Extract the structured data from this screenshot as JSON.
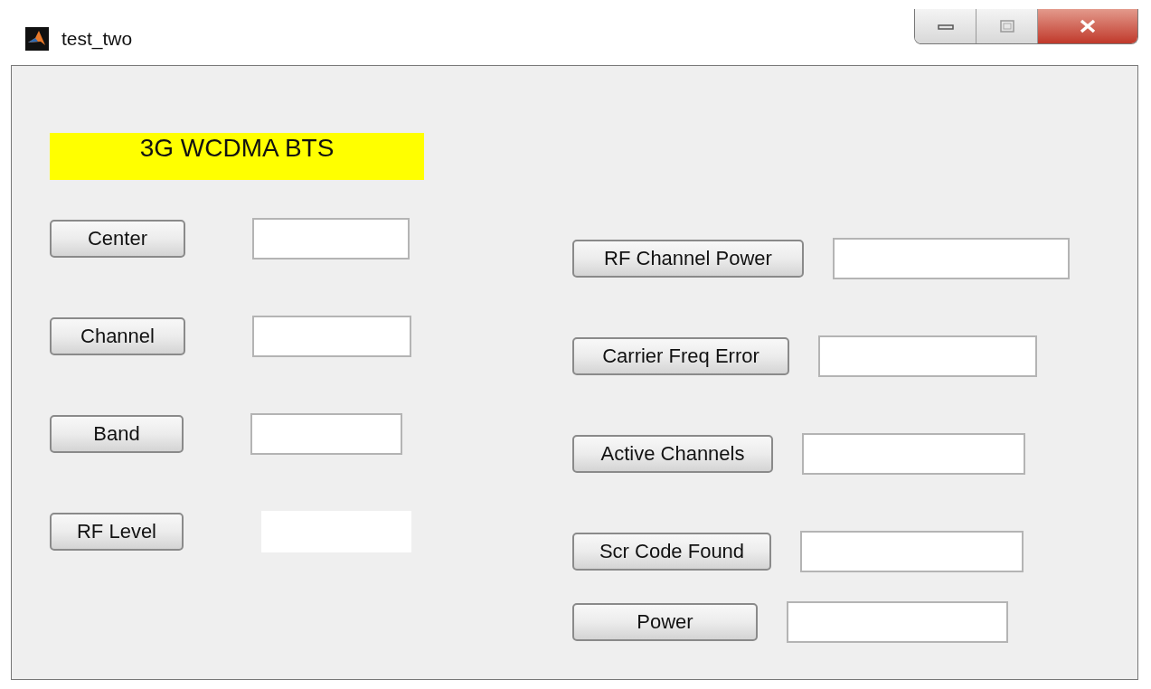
{
  "window": {
    "title": "test_two"
  },
  "banner": {
    "text": "3G WCDMA BTS"
  },
  "left_controls": [
    {
      "button": "Center",
      "field_bordered": true
    },
    {
      "button": "Channel",
      "field_bordered": true
    },
    {
      "button": "Band",
      "field_bordered": true
    },
    {
      "button": "RF Level",
      "field_bordered": false
    }
  ],
  "right_controls": [
    {
      "button": "RF Channel Power",
      "field_bordered": true
    },
    {
      "button": "Carrier Freq Error",
      "field_bordered": true
    },
    {
      "button": "Active Channels",
      "field_bordered": true
    },
    {
      "button": "Scr Code Found",
      "field_bordered": true
    },
    {
      "button": "Power",
      "field_bordered": true
    }
  ]
}
